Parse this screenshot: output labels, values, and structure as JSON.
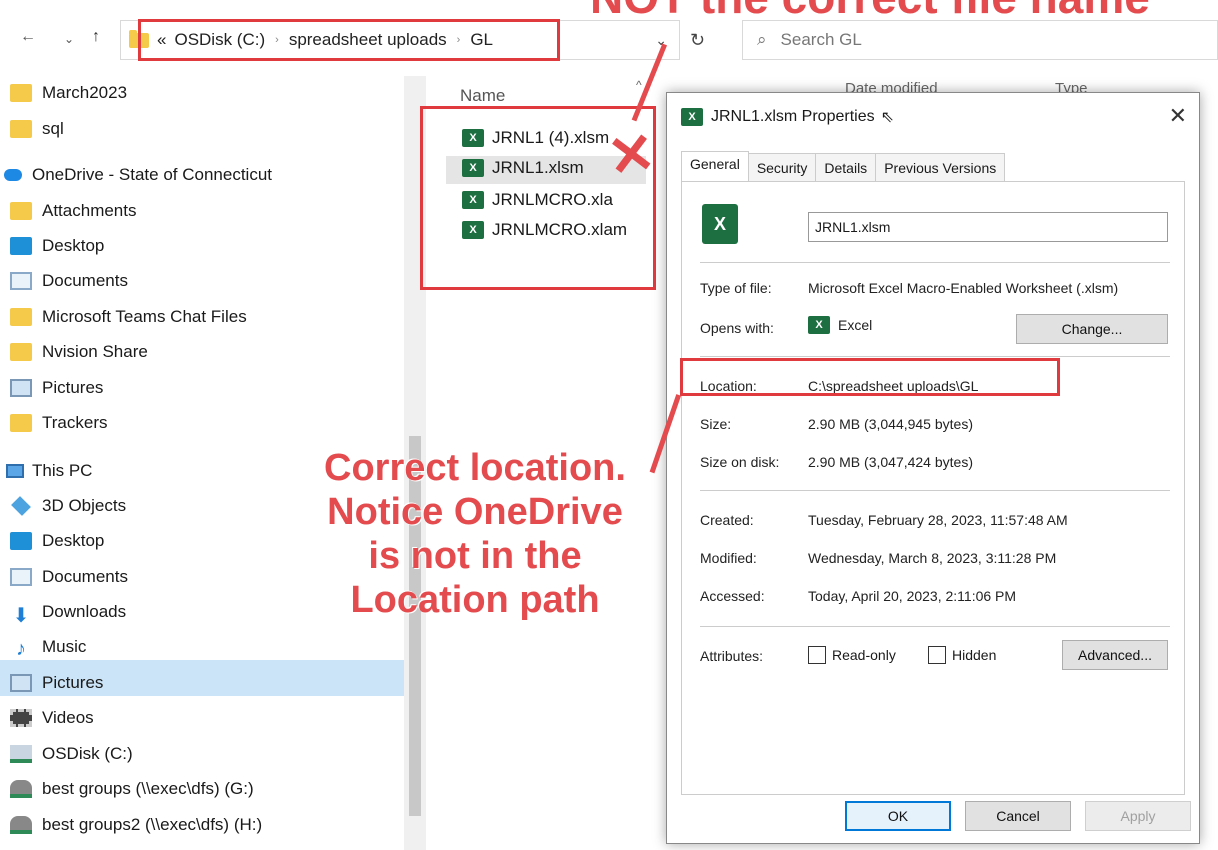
{
  "annotation_top": "NOT the correct file name",
  "annotation_main": [
    "Correct location.",
    "Notice OneDrive",
    "is not in the",
    "Location path"
  ],
  "address": {
    "overflow": "«",
    "segments": [
      "OSDisk (C:)",
      "spreadsheet uploads",
      "GL"
    ],
    "search_placeholder": "Search GL"
  },
  "sidebar": {
    "items": [
      {
        "label": "March2023",
        "icon": "folder-icon"
      },
      {
        "label": "sql",
        "icon": "folder-icon"
      },
      {
        "label": "OneDrive - State of Connecticut",
        "icon": "cloud-icon"
      },
      {
        "label": "Attachments",
        "icon": "folder-icon"
      },
      {
        "label": "Desktop",
        "icon": "desktop-icon"
      },
      {
        "label": "Documents",
        "icon": "documents-icon"
      },
      {
        "label": "Microsoft Teams Chat Files",
        "icon": "folder-icon"
      },
      {
        "label": "Nvision Share",
        "icon": "folder-icon"
      },
      {
        "label": "Pictures",
        "icon": "pictures-icon"
      },
      {
        "label": "Trackers",
        "icon": "folder-icon"
      },
      {
        "label": "This PC",
        "icon": "pc-icon"
      },
      {
        "label": "3D Objects",
        "icon": "3d-objects-icon"
      },
      {
        "label": "Desktop",
        "icon": "desktop-icon"
      },
      {
        "label": "Documents",
        "icon": "documents-icon"
      },
      {
        "label": "Downloads",
        "icon": "downloads-icon"
      },
      {
        "label": "Music",
        "icon": "music-icon"
      },
      {
        "label": "Pictures",
        "icon": "pictures-icon"
      },
      {
        "label": "Videos",
        "icon": "videos-icon"
      },
      {
        "label": "OSDisk (C:)",
        "icon": "disk-icon"
      },
      {
        "label": "best groups (\\\\exec\\dfs) (G:)",
        "icon": "network-drive-icon"
      },
      {
        "label": "best groups2 (\\\\exec\\dfs) (H:)",
        "icon": "network-drive-icon"
      }
    ]
  },
  "filelist": {
    "col_name": "Name",
    "col_date": "Date modified",
    "col_type": "Type",
    "files": [
      "JRNL1 (4).xlsm",
      "JRNL1.xlsm",
      "JRNLMCRO.xla",
      "JRNLMCRO.xlam"
    ]
  },
  "dialog": {
    "title": "JRNL1.xlsm Properties",
    "tabs": [
      "General",
      "Security",
      "Details",
      "Previous Versions"
    ],
    "filename": "JRNL1.xlsm",
    "type_label": "Type of file:",
    "type_value": "Microsoft Excel Macro-Enabled Worksheet (.xlsm)",
    "opens_label": "Opens with:",
    "opens_value": "Excel",
    "change_btn": "Change...",
    "location_label": "Location:",
    "location_value": "C:\\spreadsheet uploads\\GL",
    "size_label": "Size:",
    "size_value": "2.90 MB (3,044,945 bytes)",
    "sizedisk_label": "Size on disk:",
    "sizedisk_value": "2.90 MB (3,047,424 bytes)",
    "created_label": "Created:",
    "created_value": "Tuesday, February 28, 2023, 11:57:48 AM",
    "modified_label": "Modified:",
    "modified_value": "Wednesday, March 8, 2023, 3:11:28 PM",
    "accessed_label": "Accessed:",
    "accessed_value": "Today, April 20, 2023, 2:11:06 PM",
    "attributes_label": "Attributes:",
    "readonly_label": "Read-only",
    "hidden_label": "Hidden",
    "advanced_btn": "Advanced...",
    "ok_btn": "OK",
    "cancel_btn": "Cancel",
    "apply_btn": "Apply"
  }
}
